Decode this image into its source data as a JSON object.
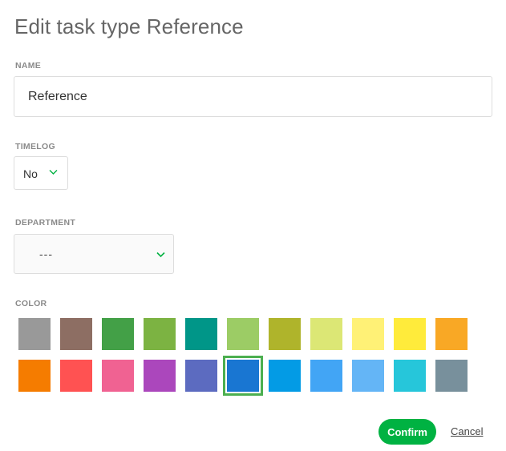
{
  "dialog": {
    "title": "Edit task type Reference"
  },
  "fields": {
    "name": {
      "label": "NAME",
      "value": "Reference"
    },
    "timelog": {
      "label": "TIMELOG",
      "value": "No"
    },
    "department": {
      "label": "DEPARTMENT",
      "value": "---"
    },
    "color": {
      "label": "COLOR",
      "selected_color": "#1976d2",
      "swatches": [
        "#999999",
        "#8d6e63",
        "#43a047",
        "#7cb342",
        "#009688",
        "#9ccc65",
        "#afb42b",
        "#dce775",
        "#fff176",
        "#ffeb3b",
        "#f9a825",
        "#f57c00",
        "#ff5252",
        "#f06292",
        "#ab47bc",
        "#5c6bc0",
        "#1976d2",
        "#039be5",
        "#42a5f5",
        "#64b5f6",
        "#26c6da",
        "#78909c"
      ]
    }
  },
  "actions": {
    "confirm_label": "Confirm",
    "cancel_label": "Cancel"
  },
  "theme": {
    "accent": "#00b242",
    "chevron": "#00b242"
  }
}
